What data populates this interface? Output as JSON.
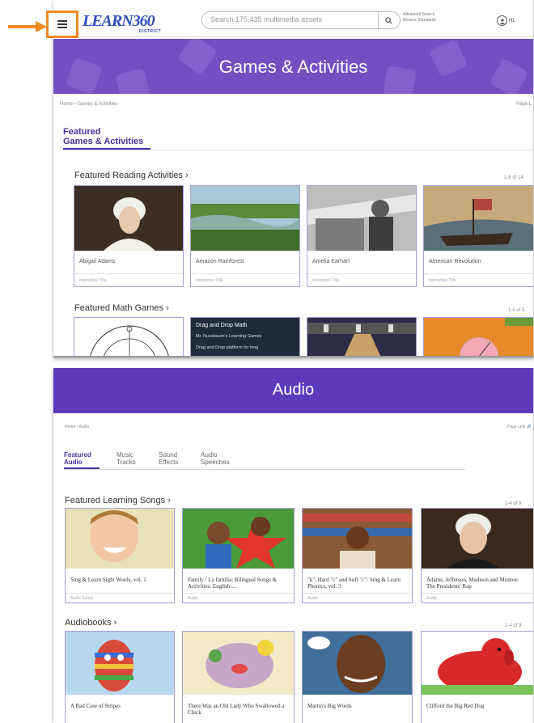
{
  "top": {
    "logo_text": "LEARN360",
    "logo_subtitle": "DISTRICT",
    "search_placeholder": "Search 175,435 multimedia assets",
    "advanced_search": "Advanced Search",
    "browse_standards": "Browse Standards",
    "user_label": "HL",
    "banner_title": "Games & Activities",
    "breadcrumb": "Home › Games & Activities",
    "page_link": "Page L",
    "featured_tab_line1": "Featured",
    "featured_tab_line2": "Games & Activities",
    "section1": {
      "title": "Featured Reading Activities ›",
      "count": "1-6 of 14"
    },
    "reading_cards": [
      {
        "name": "Abigail Adams",
        "kind": "Interactive Title"
      },
      {
        "name": "Amazon Rainforest",
        "kind": "Interactive Title"
      },
      {
        "name": "Amelia Earhart",
        "kind": "Interactive Title"
      },
      {
        "name": "American Revolution",
        "kind": "Interactive Title"
      }
    ],
    "section2": {
      "title": "Featured Math Games ›",
      "count": "1-5 of 5"
    },
    "math_card2": {
      "title": "Drag and Drop Math",
      "line2": "Mr. Nussbaum's Learning Games",
      "line3": "Drag and Drop platform for long"
    }
  },
  "bottom": {
    "banner_title": "Audio",
    "breadcrumb": "Home › Audio",
    "page_link": "Page Link",
    "tabs": [
      {
        "line1": "Featured",
        "line2": "Audio"
      },
      {
        "line1": "Music",
        "line2": "Tracks"
      },
      {
        "line1": "Sound",
        "line2": "Effects"
      },
      {
        "line1": "Audio",
        "line2": "Speeches"
      }
    ],
    "section1": {
      "title": "Featured Learning Songs ›",
      "count": "1-4 of 9"
    },
    "song_cards": [
      {
        "name": "Sing & Learn Sight Words, vol. 1",
        "kind": "Audio Series"
      },
      {
        "name": "Family / La familia: Bilingual Songs & Activities: English-...",
        "kind": "Audio"
      },
      {
        "name": "\"k\", Hard \"c\" and Soft \"c\": Sing & Learn Phonics, vol. 3",
        "kind": "Audio"
      },
      {
        "name": "Adams, Jefferson, Madison and Monroe: The Presidents' Rap",
        "kind": "Audio"
      }
    ],
    "section2": {
      "title": "Audiobooks ›",
      "count": "1-4 of 9"
    },
    "book_cards": [
      {
        "name": "A Bad Case of Stripes"
      },
      {
        "name": "There Was an Old Lady Who Swallowed a Chick"
      },
      {
        "name": "Martin's Big Words"
      },
      {
        "name": "Clifford the Big Red Dog"
      }
    ]
  },
  "colors": {
    "highlight": "#f08a24",
    "banner_top": "#7350c2",
    "banner_bottom": "#5d3bbd",
    "accent": "#4b2fa0"
  }
}
